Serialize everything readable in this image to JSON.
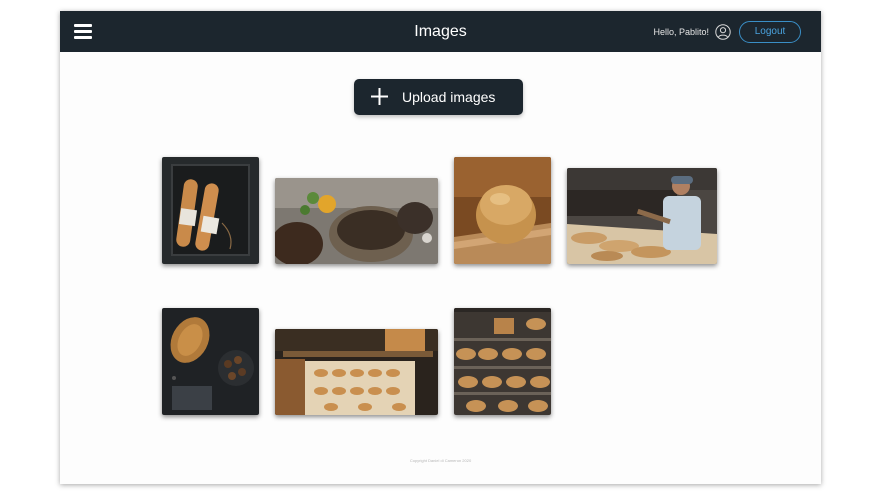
{
  "header": {
    "title": "Images",
    "greeting": "Hello, Pablito!",
    "logout_label": "Logout",
    "menu_icon": "hamburger-menu-icon",
    "user_icon": "user-circle-icon"
  },
  "upload": {
    "label": "Upload images",
    "icon": "plus-icon"
  },
  "gallery": {
    "images": [
      {
        "subject": "baguettes-on-tray"
      },
      {
        "subject": "sourdough-loaves-with-flowers"
      },
      {
        "subject": "bread-loaf-on-board"
      },
      {
        "subject": "baker-at-oven"
      },
      {
        "subject": "bread-with-chocolates"
      },
      {
        "subject": "bakery-display-case"
      },
      {
        "subject": "bread-shelves"
      }
    ]
  },
  "footer": {
    "copyright": "Copyright Daniel di Cameron 2020"
  },
  "colors": {
    "topbar": "#1c262e",
    "accent": "#3a8fc7",
    "background": "#fdfdfd"
  }
}
